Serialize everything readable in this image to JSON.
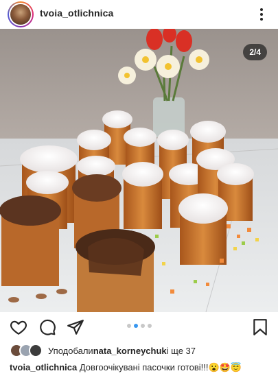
{
  "post": {
    "username": "tvoia_otlichnica",
    "slide_counter": "2/4",
    "slide_index": 2,
    "slide_total": 4
  },
  "likes": {
    "prefix": "Уподобали ",
    "user": "nata_korneychuk",
    "suffix": " і ще 37"
  },
  "caption": {
    "username": "tvoia_otlichnica",
    "text": " Довгоочікувані пасочки готові!!!😮🤩😇"
  },
  "icons": {
    "header_more": "more-vertical-icon",
    "like": "heart-icon",
    "comment": "comment-icon",
    "share": "send-icon",
    "save": "bookmark-icon"
  },
  "colors": {
    "dot_active": "#3897f0",
    "dot_inactive": "#c8c8c8"
  }
}
